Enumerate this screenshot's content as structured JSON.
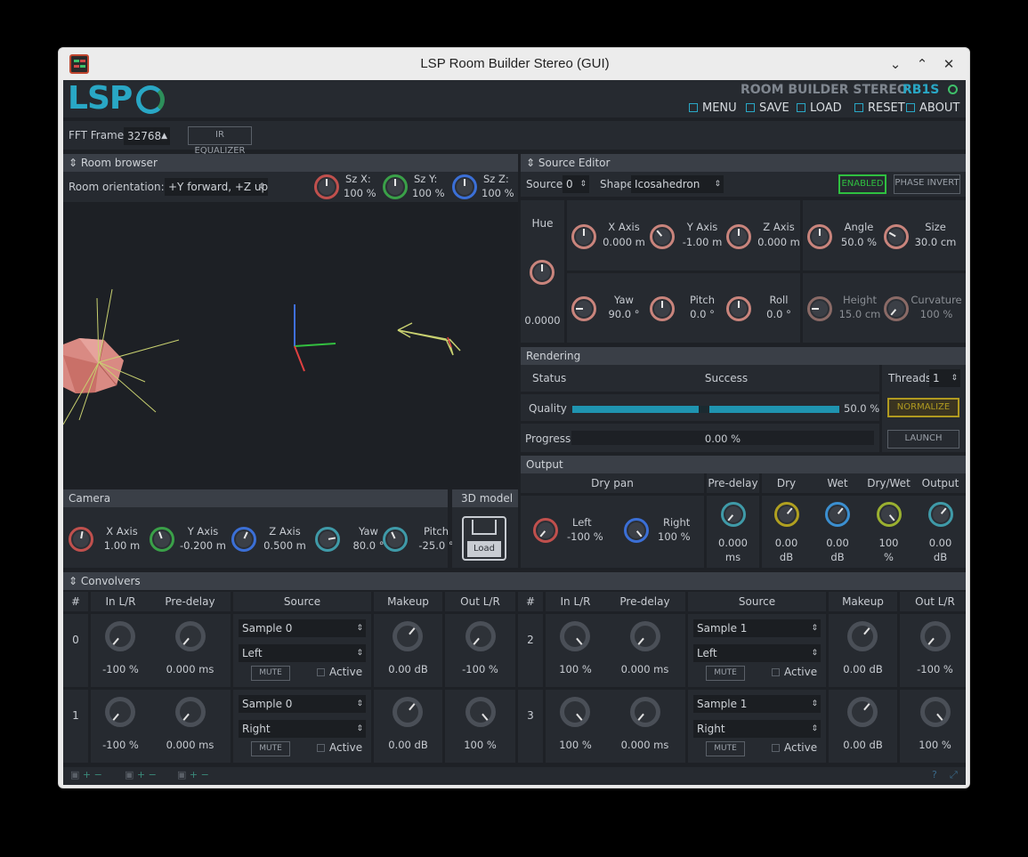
{
  "window": {
    "title": "LSP Room Builder Stereo (GUI)"
  },
  "header": {
    "logo": "LSP",
    "plugin_name": "ROOM BUILDER STEREO",
    "plugin_code": "RB1S",
    "menu": [
      {
        "label": "MENU",
        "icon": "menu-icon"
      },
      {
        "label": "SAVE",
        "icon": "save-icon"
      },
      {
        "label": "LOAD",
        "icon": "load-icon"
      },
      {
        "label": "RESET",
        "icon": "reset-icon"
      },
      {
        "label": "ABOUT",
        "icon": "about-icon"
      }
    ]
  },
  "toolbar": {
    "fft_label": "FFT Frame",
    "fft_value": "32768",
    "ir_eq_label": "IR EQUALIZER"
  },
  "room_browser": {
    "title": "Room browser",
    "orientation_label": "Room orientation:",
    "orientation_value": "+Y forward, +Z up",
    "sizes": [
      {
        "label": "Sz X:",
        "value": "100 %",
        "color": "#c0504d",
        "angle": 0
      },
      {
        "label": "Sz Y:",
        "value": "100 %",
        "color": "#3aa048",
        "angle": 0
      },
      {
        "label": "Sz Z:",
        "value": "100 %",
        "color": "#3b6fd6",
        "angle": 0
      }
    ]
  },
  "camera": {
    "title": "Camera",
    "knobs": [
      {
        "label": "X Axis",
        "value": "1.00 m",
        "color": "#c0504d",
        "angle": 10
      },
      {
        "label": "Y Axis",
        "value": "-0.200 m",
        "color": "#3aa048",
        "angle": -20
      },
      {
        "label": "Z Axis",
        "value": "0.500 m",
        "color": "#3b6fd6",
        "angle": 25
      },
      {
        "label": "Yaw",
        "value": "80.0 °",
        "color": "#3f9aa8",
        "angle": 80
      },
      {
        "label": "Pitch",
        "value": "-25.0 °",
        "color": "#3f9aa8",
        "angle": -25
      }
    ]
  },
  "model3d": {
    "title": "3D model",
    "load_label": "Load"
  },
  "source_editor": {
    "title": "Source Editor",
    "source_label": "Source:",
    "source_value": "0",
    "shape_label": "Shape",
    "shape_value": "Icosahedron",
    "enabled_label": "ENABLED",
    "phase_label": "PHASE INVERT",
    "hue": {
      "label": "Hue",
      "value": "0.0000"
    },
    "pos_knobs": [
      {
        "label": "X Axis",
        "value": "0.000 m",
        "angle": 0
      },
      {
        "label": "Y Axis",
        "value": "-1.00 m",
        "angle": -40
      },
      {
        "label": "Z Axis",
        "value": "0.000 m",
        "angle": 0
      }
    ],
    "rot_knobs": [
      {
        "label": "Yaw",
        "value": "90.0 °",
        "angle": -90
      },
      {
        "label": "Pitch",
        "value": "0.0 °",
        "angle": 0
      },
      {
        "label": "Roll",
        "value": "0.0 °",
        "angle": 0
      }
    ],
    "shape_knobs": [
      {
        "label": "Angle",
        "value": "50.0 %",
        "angle": 0
      },
      {
        "label": "Size",
        "value": "30.0 cm",
        "angle": -60
      }
    ],
    "shape_knobs2": [
      {
        "label": "Height",
        "value": "15.0 cm",
        "angle": -90
      },
      {
        "label": "Curvature",
        "value": "100 %",
        "angle": -140
      }
    ]
  },
  "rendering": {
    "title": "Rendering",
    "status_label": "Status",
    "status_value": "Success",
    "threads_label": "Threads",
    "threads_value": "1",
    "quality_label": "Quality",
    "quality_value": "50.0 %",
    "quality_fraction": 0.5,
    "normalize_label": "NORMALIZE",
    "progress_label": "Progress",
    "progress_value": "0.00 %",
    "launch_label": "LAUNCH"
  },
  "output": {
    "title": "Output",
    "dry_pan_label": "Dry pan",
    "pan": [
      {
        "label": "Left",
        "value": "-100 %",
        "color": "#c0504d",
        "angle": -140
      },
      {
        "label": "Right",
        "value": "100 %",
        "color": "#3b6fd6",
        "angle": 140
      }
    ],
    "cols": [
      {
        "title": "Pre-delay",
        "value": "0.000",
        "unit": "ms",
        "color": "#3f9aa8",
        "angle": -140
      },
      {
        "title": "Dry",
        "value": "0.00",
        "unit": "dB",
        "color": "#b0a020",
        "angle": 40
      },
      {
        "title": "Wet",
        "value": "0.00",
        "unit": "dB",
        "color": "#3b8fd0",
        "angle": 40
      },
      {
        "title": "Dry/Wet",
        "value": "100",
        "unit": "%",
        "color": "#9ab030",
        "angle": 140
      },
      {
        "title": "Output",
        "value": "0.00",
        "unit": "dB",
        "color": "#3f9aa8",
        "angle": 40
      }
    ]
  },
  "convolvers": {
    "title": "Convolvers",
    "headers": [
      "#",
      "In L/R",
      "Pre-delay",
      "Source",
      "Makeup",
      "Out L/R"
    ],
    "mute_label": "MUTE",
    "active_label": "Active",
    "rows": [
      {
        "n": "0",
        "in": "-100 %",
        "in_angle": -140,
        "pre": "0.000 ms",
        "sample": "Sample 0",
        "channel": "Left",
        "makeup": "0.00 dB",
        "out": "-100 %",
        "out_angle": -140
      },
      {
        "n": "1",
        "in": "-100 %",
        "in_angle": -140,
        "pre": "0.000 ms",
        "sample": "Sample 0",
        "channel": "Right",
        "makeup": "0.00 dB",
        "out": "100 %",
        "out_angle": 140
      },
      {
        "n": "2",
        "in": "100 %",
        "in_angle": 140,
        "pre": "0.000 ms",
        "sample": "Sample 1",
        "channel": "Left",
        "makeup": "0.00 dB",
        "out": "-100 %",
        "out_angle": -140
      },
      {
        "n": "3",
        "in": "100 %",
        "in_angle": 140,
        "pre": "0.000 ms",
        "sample": "Sample 1",
        "channel": "Right",
        "makeup": "0.00 dB",
        "out": "100 %",
        "out_angle": 140
      }
    ]
  }
}
